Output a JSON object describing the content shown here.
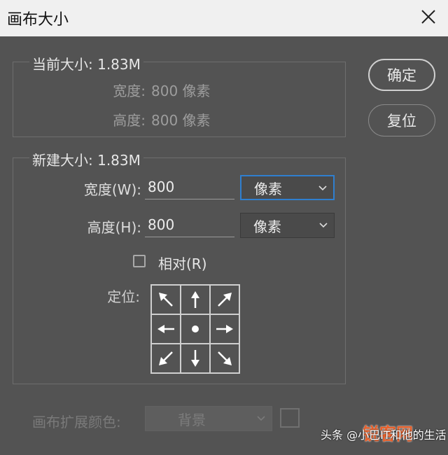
{
  "dialog": {
    "title": "画布大小",
    "ok_label": "确定",
    "reset_label": "复位"
  },
  "current_size": {
    "legend": "当前大小: 1.83M",
    "width_label": "宽度:",
    "width_value": "800 像素",
    "height_label": "高度:",
    "height_value": "800 像素"
  },
  "new_size": {
    "legend": "新建大小: 1.83M",
    "width_label": "宽度(W):",
    "width_value": "800",
    "width_unit": "像素",
    "height_label": "高度(H):",
    "height_value": "800",
    "height_unit": "像素",
    "relative_label": "相对(R)",
    "relative_checked": false,
    "anchor_label": "定位:"
  },
  "extension": {
    "label": "画布扩展颜色:",
    "value": "背景"
  },
  "watermark": {
    "text": "头条 @小巴IT和他的生活",
    "logo": "锐客网"
  },
  "colors": {
    "background": "#535353",
    "focus": "#2f7fcf"
  }
}
